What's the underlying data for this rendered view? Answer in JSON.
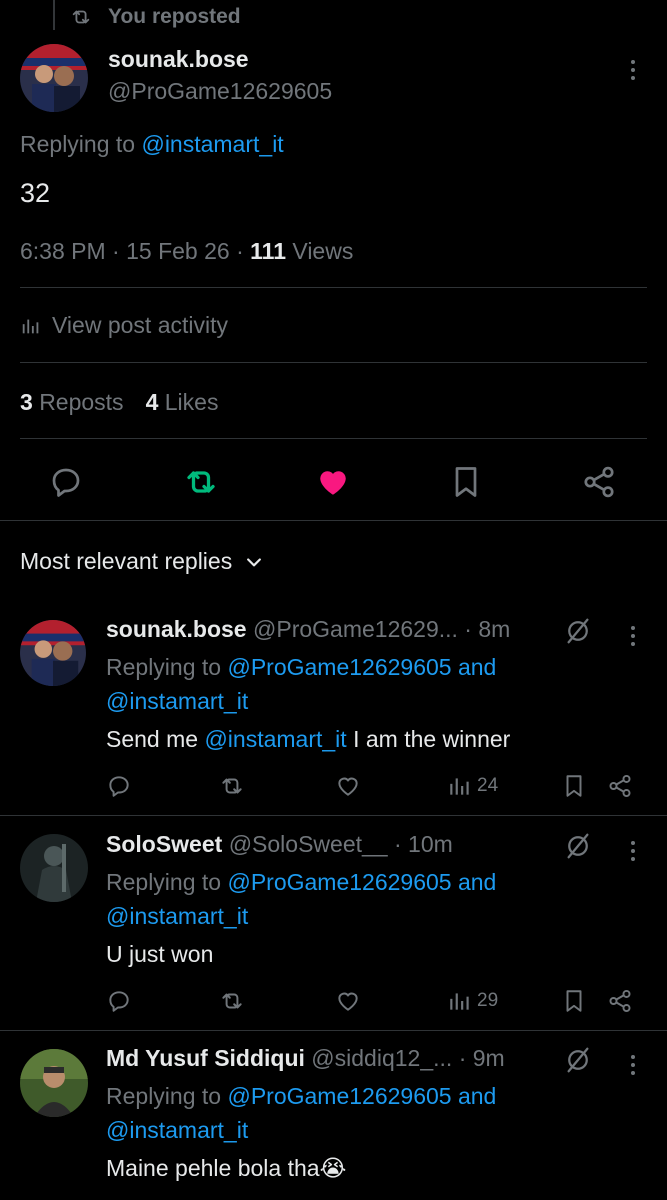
{
  "repost_banner": {
    "label": "You reposted",
    "icon": "repost-icon"
  },
  "post": {
    "author_name": "sounak.bose",
    "author_handle": "@ProGame12629605",
    "replying_prefix": "Replying to",
    "replying_to": "@instamart_it",
    "text": "32",
    "time": "6:38 PM",
    "date": "15 Feb 26",
    "views_count": "111",
    "views_label": "Views",
    "activity_label": "View post activity",
    "reposts_count": "3",
    "reposts_label": "Reposts",
    "likes_count": "4",
    "likes_label": "Likes",
    "liked": true,
    "reposted": true
  },
  "colors": {
    "accent": "#1d9bf0",
    "repost": "#00ba7c",
    "like": "#f91880",
    "muted": "#71767b",
    "text": "#e7e9ea"
  },
  "sort": {
    "label": "Most relevant replies"
  },
  "replies": [
    {
      "name": "sounak.bose",
      "handle": "@ProGame12629...",
      "time": "· 8m",
      "replying_prefix": "Replying to",
      "replying_to": "@ProGame12629605 and",
      "replying_to2": "@instamart_it",
      "text_before": "Send me ",
      "text_mention": "@instamart_it",
      "text_after": " I am the winner",
      "views": "24"
    },
    {
      "name": "SoloSweet",
      "handle": "@SoloSweet__",
      "time": "· 10m",
      "replying_prefix": "Replying to",
      "replying_to": "@ProGame12629605 and",
      "replying_to2": "@instamart_it",
      "text_before": "U just won",
      "text_mention": "",
      "text_after": "",
      "views": "29"
    },
    {
      "name": "Md Yusuf Siddiqui",
      "handle": "@siddiq12_...",
      "time": "· 9m",
      "replying_prefix": "Replying to",
      "replying_to": "@ProGame12629605 and",
      "replying_to2": "@instamart_it",
      "text_before": "Maine pehle bola tha😭",
      "text_mention": "",
      "text_after": "",
      "views": ""
    }
  ]
}
